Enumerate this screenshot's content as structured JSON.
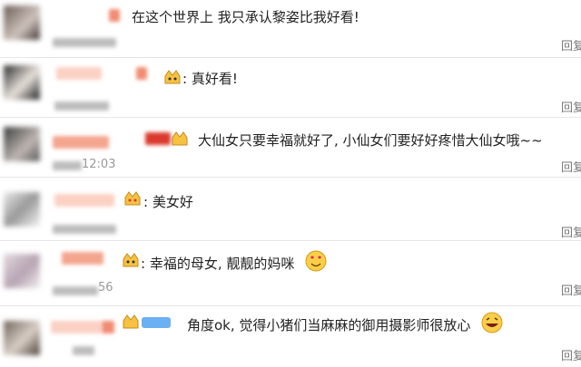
{
  "comments": [
    {
      "text": "在这个世界上 我只承认黎姿比我好看!",
      "time": "",
      "reply": "回复"
    },
    {
      "text": ": 真好看!",
      "time": "",
      "reply": "回复"
    },
    {
      "text": "大仙女只要幸福就好了, 小仙女们要好好疼惜大仙女哦~~",
      "time": "12:03",
      "reply": "回复"
    },
    {
      "text": ": 美女好",
      "time": "",
      "reply": "回复"
    },
    {
      "text": ": 幸福的母女, 靓靓的妈咪",
      "time": "56",
      "reply": "回复"
    },
    {
      "text": "角度ok, 觉得小猪们当麻麻的御用摄影师很放心",
      "time": "",
      "reply": "回复"
    }
  ],
  "icons": {
    "crown_emoji": "crown-emoji",
    "love_emoji": "love-eyes-emoji",
    "laugh_emoji": "laughing-emoji"
  },
  "colors": {
    "name_blur": "#f4a58e",
    "divider": "#e6e6e6",
    "crown": "#f5c242",
    "badge_blue": "#6ab0f3"
  }
}
